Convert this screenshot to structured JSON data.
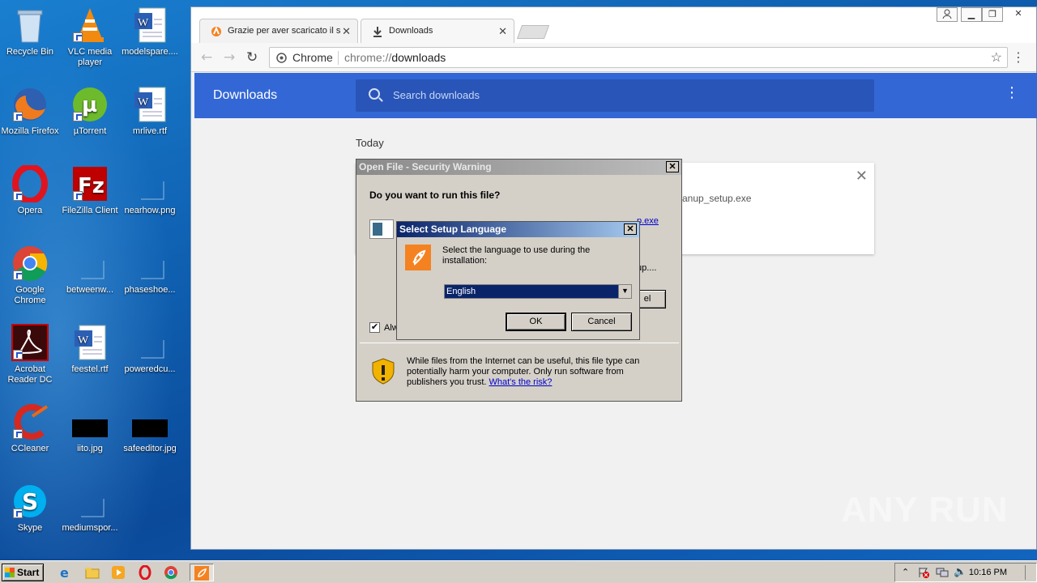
{
  "desktop": {
    "icons": [
      {
        "label": "Recycle Bin"
      },
      {
        "label": "VLC media player"
      },
      {
        "label": "modelspare...."
      },
      {
        "label": "Mozilla Firefox"
      },
      {
        "label": "µTorrent"
      },
      {
        "label": "mrlive.rtf"
      },
      {
        "label": "Opera"
      },
      {
        "label": "FileZilla Client"
      },
      {
        "label": "nearhow.png"
      },
      {
        "label": "Google Chrome"
      },
      {
        "label": "betweenw..."
      },
      {
        "label": "phaseshoe..."
      },
      {
        "label": "Acrobat Reader DC"
      },
      {
        "label": "feestel.rtf"
      },
      {
        "label": "poweredcu..."
      },
      {
        "label": "CCleaner"
      },
      {
        "label": "iito.jpg"
      },
      {
        "label": "safeeditor.jpg"
      },
      {
        "label": "Skype"
      },
      {
        "label": "mediumspor..."
      }
    ]
  },
  "browser": {
    "tabs": [
      {
        "label": "Grazie per aver scaricato il s"
      },
      {
        "label": "Downloads"
      }
    ],
    "omnibox": {
      "site": "Chrome",
      "scheme": "chrome://",
      "path": "downloads"
    },
    "page": {
      "title": "Downloads",
      "search_placeholder": "Search downloads",
      "section": "Today",
      "file_fragment": "anup_setup.exe"
    }
  },
  "security_dialog": {
    "title": "Open File - Security Warning",
    "question": "Do you want to run this file?",
    "name_fragment": "Name: ...\\ccleanup_setup.exe",
    "link_fragment": "p.exe",
    "publisher_fragment": "up....",
    "cancel_fragment": "el",
    "checkbox_fragment": "Alw",
    "warning": "While files from the Internet can be useful, this file type can potentially harm your computer. Only run software from publishers you trust.",
    "risk_link": "What's the risk?"
  },
  "language_dialog": {
    "title": "Select Setup Language",
    "message": "Select the language to use during the installation:",
    "selected": "English",
    "ok": "OK",
    "cancel": "Cancel"
  },
  "taskbar": {
    "start": "Start",
    "clock": "10:16 PM"
  },
  "watermark": "ANY RUN"
}
